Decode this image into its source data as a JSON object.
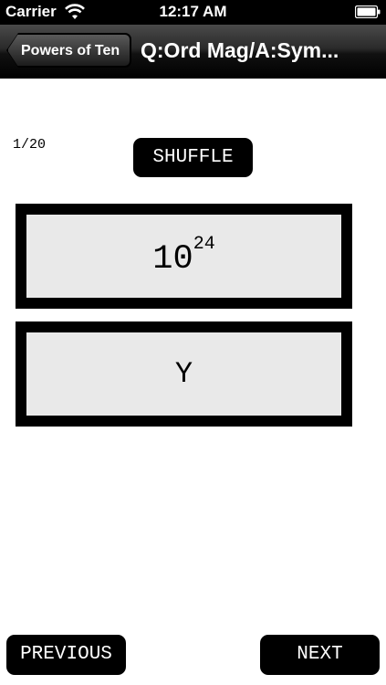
{
  "status_bar": {
    "carrier": "Carrier",
    "time": "12:17 AM",
    "icons": [
      "wifi-icon",
      "battery-icon"
    ]
  },
  "nav": {
    "back_label": "Powers of Ten",
    "title": "Q:Ord Mag/A:Sym..."
  },
  "quiz": {
    "counter": "1/20",
    "shuffle_label": "SHUFFLE",
    "question_base": "10",
    "question_exponent": "24",
    "answer": "Y"
  },
  "footer": {
    "previous_label": "PREVIOUS",
    "next_label": "NEXT"
  },
  "colors": {
    "accent": "#000000",
    "card_bg": "#e9e9e9"
  }
}
